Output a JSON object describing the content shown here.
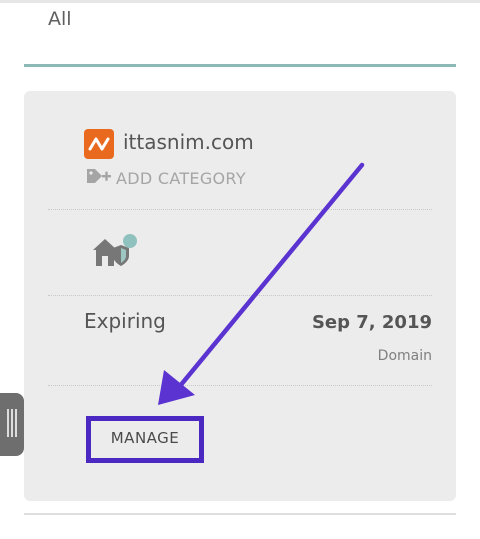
{
  "filter": {
    "label": "All"
  },
  "domain": {
    "name": "ittasnim.com",
    "add_category_label": "ADD CATEGORY",
    "status": "Expiring",
    "expiry_date": "Sep 7, 2019",
    "product_type": "Domain",
    "manage_label": "MANAGE"
  },
  "icons": {
    "brand": "namecheap-logo-icon",
    "add_category": "tag-plus-icon",
    "home_protection": "home-shield-icon",
    "side_handle": "drag-handle-icon"
  },
  "colors": {
    "brand_orange": "#e96a1f",
    "accent_teal": "#8db9b6",
    "highlight_purple": "#4b28c2",
    "card_bg": "#ececec"
  }
}
